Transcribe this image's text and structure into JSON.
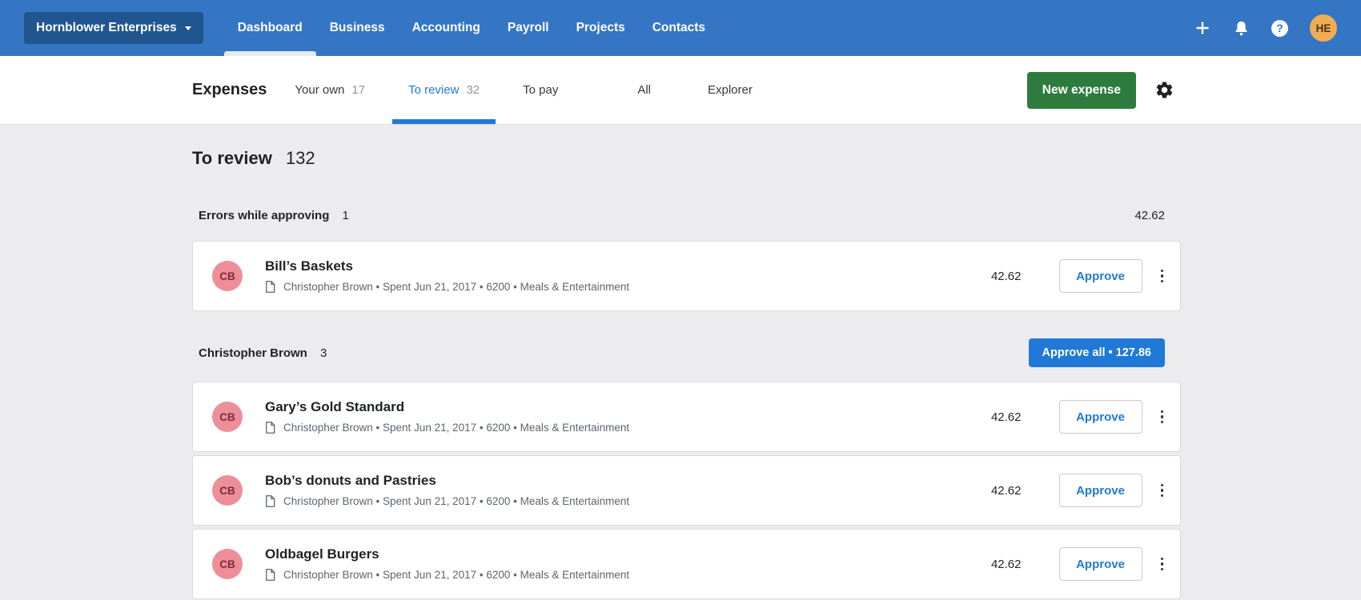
{
  "topbar": {
    "org_button": "Hornblower Enterprises",
    "nav": [
      "Dashboard",
      "Business",
      "Accounting",
      "Payroll",
      "Projects",
      "Contacts"
    ],
    "active_nav": "Dashboard",
    "help_glyph": "?",
    "avatar_initials": "HE"
  },
  "header": {
    "title": "Expenses",
    "tabs": [
      {
        "label": "Your own",
        "count": "17",
        "active": false
      },
      {
        "label": "To review",
        "count": "32",
        "active": true
      },
      {
        "label": "To pay",
        "active": false
      },
      {
        "label": "All",
        "active": false
      },
      {
        "label": "Explorer",
        "active": false
      }
    ],
    "new_expense_label": "New expense"
  },
  "page": {
    "title": "To review",
    "count": "132"
  },
  "review_sections": [
    {
      "title": "Errors while approving",
      "count": "1",
      "total": "42.62",
      "expenses": [
        {
          "initials": "CB",
          "title": "Bill’s Baskets",
          "meta": "Christopher Brown • Spent Jun 21, 2017 • 6200 • Meals & Entertainment",
          "amount": "42.62",
          "approve_label": "Approve"
        }
      ]
    },
    {
      "title": "Christopher Brown",
      "count": "3",
      "approve_all_label": "Approve all • 127.86",
      "expenses": [
        {
          "initials": "CB",
          "title": "Gary’s Gold Standard",
          "meta": "Christopher Brown • Spent Jun 21, 2017 • 6200 • Meals & Entertainment",
          "amount": "42.62",
          "approve_label": "Approve"
        },
        {
          "initials": "CB",
          "title": "Bob’s donuts and Pastries",
          "meta": "Christopher Brown • Spent Jun 21, 2017 • 6200 • Meals & Entertainment",
          "amount": "42.62",
          "approve_label": "Approve"
        },
        {
          "initials": "CB",
          "title": "Oldbagel Burgers",
          "meta": "Christopher Brown • Spent Jun 21, 2017 • 6200 • Meals & Entertainment",
          "amount": "42.62",
          "approve_label": "Approve"
        }
      ]
    }
  ],
  "icons": {
    "topbar": [
      "plus-icon",
      "bell-icon",
      "help-icon"
    ],
    "org_button": "chevron-down-icon",
    "settings": "gear-icon",
    "card_meta": "document-icon",
    "card_menu": "kebab-menu-icon"
  },
  "colors": {
    "topbar": "#3476c4",
    "org_button": "#215590",
    "active_tab": "#2079d6",
    "primary_button_green": "#2e7b3e",
    "approve_all_button": "#2079d6",
    "avatar_pink": "#ed8e99",
    "avatar_orange": "#f0ac52",
    "background": "#ececee"
  }
}
